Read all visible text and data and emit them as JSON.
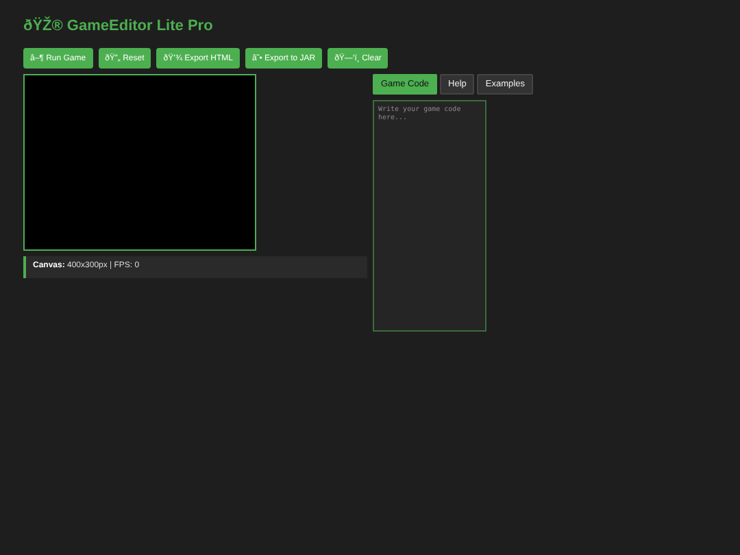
{
  "title": "ðŸŽ® GameEditor Lite Pro",
  "toolbar": [
    "â–¶ Run Game",
    "ðŸ”„ Reset",
    "ðŸ’¾ Export HTML",
    "â˜• Export to JAR",
    "ðŸ—‘ï¸ Clear"
  ],
  "status": {
    "label": "Canvas:",
    "text": "400x300px | FPS: 0"
  },
  "tabs": [
    {
      "label": "Game Code",
      "selected": true
    },
    {
      "label": "Help",
      "selected": false
    },
    {
      "label": "Examples",
      "selected": false
    }
  ],
  "editor": {
    "placeholder": "Write your game code here..."
  }
}
